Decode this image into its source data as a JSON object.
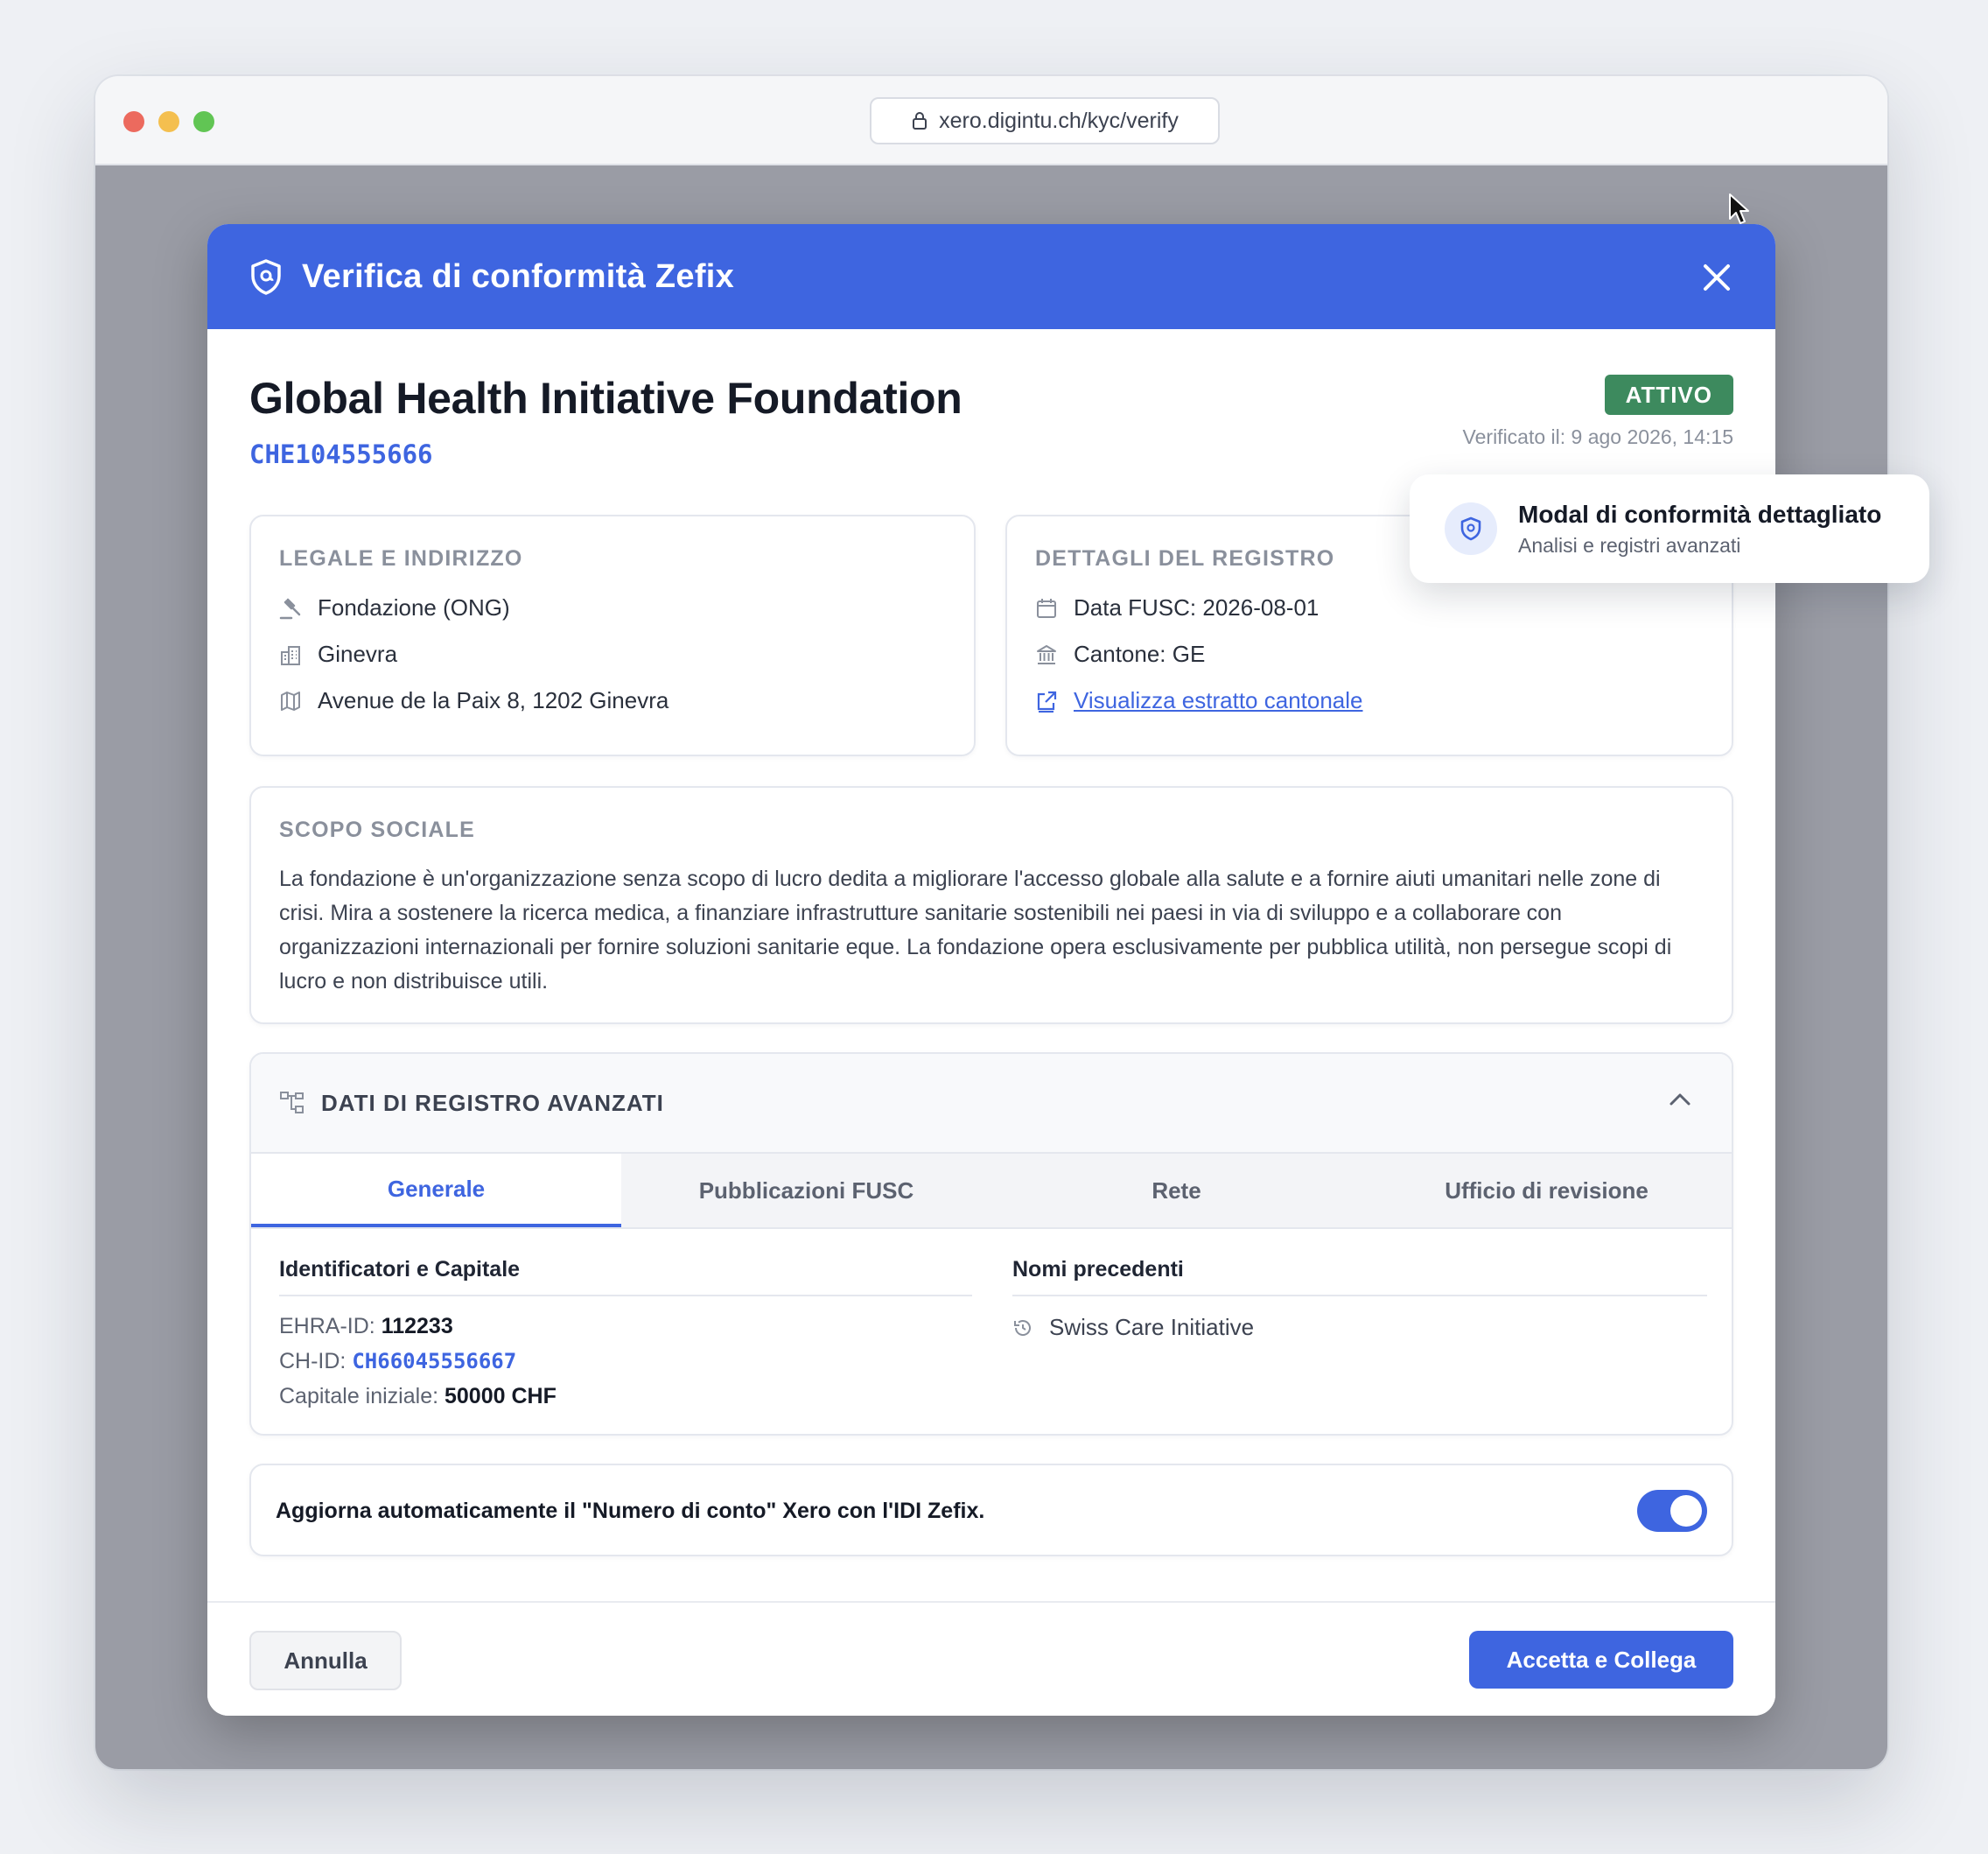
{
  "browser": {
    "url": "xero.digintu.ch/kyc/verify"
  },
  "modal": {
    "title": "Verifica di conformità Zefix",
    "company_name": "Global Health Initiative Foundation",
    "uid": "CHE104555666",
    "status": "ATTIVO",
    "verified_at": "Verificato il: 9 ago 2026, 14:15",
    "legal": {
      "title": "LEGALE E INDIRIZZO",
      "legal_form": "Fondazione (ONG)",
      "city": "Ginevra",
      "address": "Avenue de la Paix 8, 1202 Ginevra"
    },
    "registry": {
      "title": "DETTAGLI DEL REGISTRO",
      "fusc_date": "Data FUSC: 2026-08-01",
      "canton": "Cantone: GE",
      "extract_link": "Visualizza estratto cantonale"
    },
    "purpose": {
      "title": "SCOPO SOCIALE",
      "text": "La fondazione è un'organizzazione senza scopo di lucro dedita a migliorare l'accesso globale alla salute e a fornire aiuti umanitari nelle zone di crisi. Mira a sostenere la ricerca medica, a finanziare infrastrutture sanitarie sostenibili nei paesi in via di sviluppo e a collaborare con organizzazioni internazionali per fornire soluzioni sanitarie eque. La fondazione opera esclusivamente per pubblica utilità, non persegue scopi di lucro e non distribuisce utili."
    },
    "advanced": {
      "title": "DATI DI REGISTRO AVANZATI",
      "tabs": [
        "Generale",
        "Pubblicazioni FUSC",
        "Rete",
        "Ufficio di revisione"
      ],
      "active_tab": "Generale",
      "identifiers": {
        "title": "Identificatori e Capitale",
        "ehra_label": "EHRA-ID:",
        "ehra_value": "112233",
        "chid_label": "CH-ID:",
        "chid_value": "CH66045556667",
        "capital_label": "Capitale iniziale:",
        "capital_value": "50000 CHF"
      },
      "previous_names": {
        "title": "Nomi precedenti",
        "items": [
          "Swiss Care Initiative"
        ]
      }
    },
    "sync": {
      "label": "Aggiorna automaticamente il \"Numero di conto\" Xero con l'IDI Zefix.",
      "enabled": true
    },
    "footer": {
      "cancel": "Annulla",
      "accept": "Accetta e Collega"
    }
  },
  "tooltip": {
    "title": "Modal di conformità dettagliato",
    "subtitle": "Analisi e registri avanzati"
  },
  "colors": {
    "primary": "#3e65e0",
    "status": "#3d8a5e",
    "overlay": "#9a9ca5"
  },
  "icons": [
    "lock-icon",
    "shield-icon",
    "close-icon",
    "gavel-icon",
    "building-icon",
    "map-icon",
    "calendar-icon",
    "bank-icon",
    "external-link-icon",
    "hierarchy-icon",
    "chevron-up-icon",
    "history-icon",
    "cursor-icon"
  ]
}
